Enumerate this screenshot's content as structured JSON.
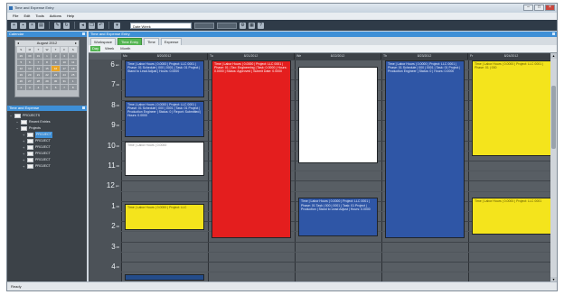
{
  "window": {
    "title": "Time and Expense Entry"
  },
  "menu": [
    "File",
    "Edit",
    "Tools",
    "Actions",
    "Help"
  ],
  "toolbar": {
    "search_value": "Date Week"
  },
  "left": {
    "calendar_header": "Calendar",
    "month_label": "August 2012",
    "weekdays": [
      "S",
      "M",
      "T",
      "W",
      "T",
      "F",
      "S"
    ],
    "days": [
      "29",
      "30",
      "31",
      "1",
      "2",
      "3",
      "4",
      "5",
      "6",
      "7",
      "8",
      "9",
      "10",
      "11",
      "12",
      "13",
      "14",
      "15",
      "16",
      "17",
      "18",
      "19",
      "20",
      "21",
      "22",
      "23",
      "24",
      "25",
      "26",
      "27",
      "28",
      "29",
      "30",
      "31",
      "1",
      "2",
      "3",
      "4",
      "5",
      "6",
      "7",
      "8"
    ],
    "selected_day_index": 18,
    "tree_header": "Time and Expense",
    "tree": [
      {
        "label": "PROJECTS",
        "level": 0,
        "selected": false
      },
      {
        "label": "Recent Entries",
        "level": 1,
        "selected": false
      },
      {
        "label": "Projects",
        "level": 1,
        "selected": false
      },
      {
        "label": "PROJECT",
        "level": 2,
        "selected": true
      },
      {
        "label": "PROJECT",
        "level": 2,
        "selected": false
      },
      {
        "label": "PROJECT",
        "level": 2,
        "selected": false
      },
      {
        "label": "PROJECT",
        "level": 2,
        "selected": false
      },
      {
        "label": "PROJECT",
        "level": 2,
        "selected": false
      },
      {
        "label": "PROJECT",
        "level": 2,
        "selected": false
      }
    ]
  },
  "main": {
    "header": "Time and Expense Entry",
    "tabs": [
      "Workspace",
      "Time Entry",
      "Time",
      "Expense"
    ],
    "active_tab": 1,
    "subtabs": [
      "Day",
      "Week",
      "Month"
    ],
    "active_subtab": 0,
    "days": [
      {
        "name": "Mo",
        "date": "8/20/2012"
      },
      {
        "name": "Tu",
        "date": "8/21/2012"
      },
      {
        "name": "We",
        "date": "8/22/2012"
      },
      {
        "name": "Th",
        "date": "8/23/2012"
      },
      {
        "name": "Fr",
        "date": "8/24/2012"
      }
    ],
    "hours": [
      {
        "h": "6",
        "m": "am"
      },
      {
        "h": "7",
        "m": "00"
      },
      {
        "h": "8",
        "m": "00"
      },
      {
        "h": "9",
        "m": "00"
      },
      {
        "h": "10",
        "m": "00"
      },
      {
        "h": "11",
        "m": "00"
      },
      {
        "h": "12",
        "m": "pm"
      },
      {
        "h": "1",
        "m": "00"
      },
      {
        "h": "2",
        "m": "00"
      },
      {
        "h": "3",
        "m": "00"
      },
      {
        "h": "4",
        "m": "00"
      }
    ],
    "appointments": [
      {
        "day": 0,
        "start": 0,
        "end": 1.9,
        "color": "blue",
        "text": "Time | Labor Hours | 0.0000 | Project: LLC 0001 | Phase: 01 Schedule | 000 | 0001 | Task: 01 Project | Stand to Lead Adjust | Hours: 0.0000"
      },
      {
        "day": 0,
        "start": 2.0,
        "end": 3.9,
        "color": "blue",
        "text": "Time | Labor Hours | 0.0000 | Project: LLC 0001 | Phase: 01 Schedule | 000 | 0001 | Task: 01 Project | Production Engineer | Status: 0 | Report: Submitted | Hours: 0.0000"
      },
      {
        "day": 0,
        "start": 4.0,
        "end": 5.8,
        "color": "white",
        "text": "Time | Labor Hours | 0.0000"
      },
      {
        "day": 0,
        "start": 7.1,
        "end": 8.5,
        "color": "yellow",
        "text": "Time | Labor Hours | 0.0000 | Project: LLC"
      },
      {
        "day": 0,
        "start": 10.6,
        "end": 11.0,
        "color": "navy",
        "text": ""
      },
      {
        "day": 1,
        "start": 0,
        "end": 8.9,
        "color": "red",
        "text": "Time | Labor Hours | 0.0000 | Project: LLC 0001 | Phase: 01 | Tax: Engineering | Task: 0.0000 | Hours: 0.0000 | Status: Approved | Submit Date: 0.0000"
      },
      {
        "day": 2,
        "start": 0.3,
        "end": 5.2,
        "color": "white",
        "text": ""
      },
      {
        "day": 2,
        "start": 6.8,
        "end": 8.8,
        "color": "blue",
        "text": "Time | Labor Hours | 0.0000 | Project: LLC 0001 | Phase: 01 Task | 000 | 0001 | Task: 01 Project | Production | Stand to Lead Adjust | Hours: 0.0000"
      },
      {
        "day": 3,
        "start": 0,
        "end": 8.9,
        "color": "blue",
        "text": "Time | Labor Hours | 0.0000 | Project: LLC 0001 | Phase: 01 Schedule | 000 | 0001 | Task: 01 Project | Production Engineer | Status: 0 | Hours: 0.0000"
      },
      {
        "day": 4,
        "start": 0,
        "end": 4.8,
        "color": "yellow",
        "text": "Time | Labor Hours | 0.0000 | Project: LLC 0001 | Phase: 01 | 000"
      },
      {
        "day": 4,
        "start": 6.8,
        "end": 8.7,
        "color": "yellow",
        "text": "Time | Labor Hours | 0.0000 | Project: LLC 0001"
      }
    ]
  },
  "status": {
    "text": "Ready"
  },
  "colors": {
    "accent": "#3e8fd6",
    "active_tab": "#53b552",
    "red": "#e41e1e",
    "yellow": "#f4e41c",
    "blue": "#2f56a6"
  }
}
